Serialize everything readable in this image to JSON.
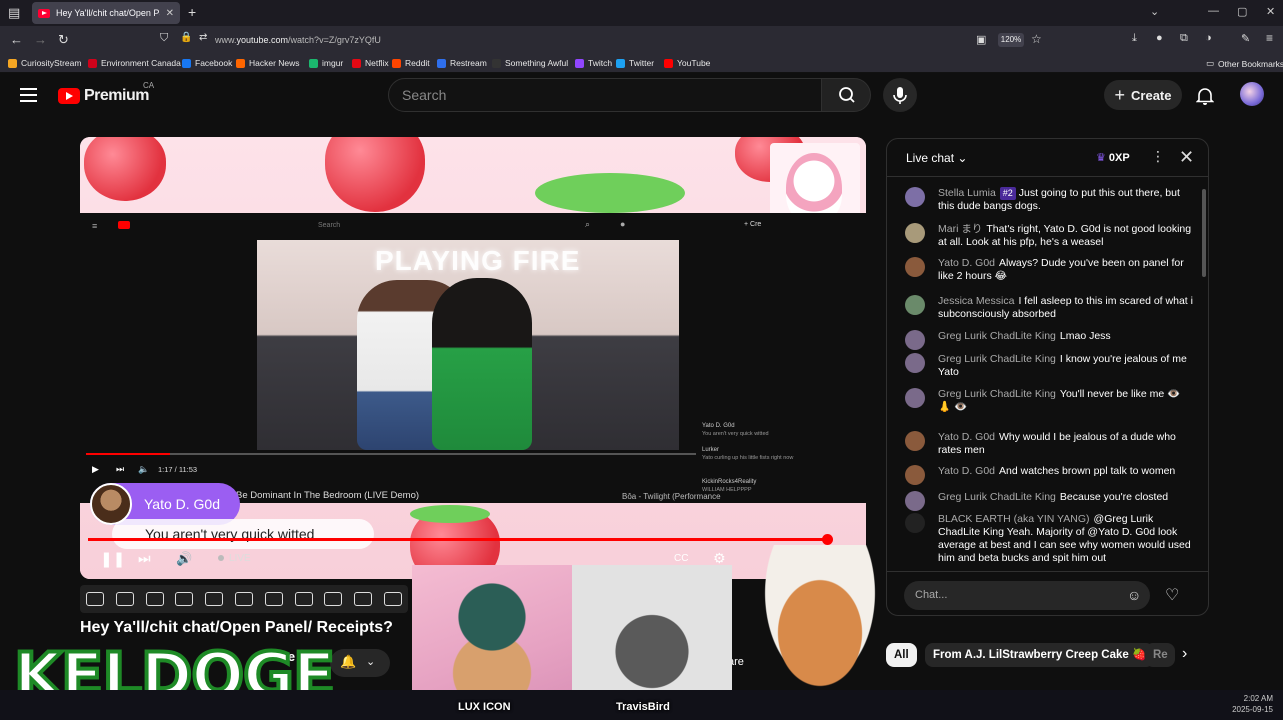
{
  "browser": {
    "tab_title": "Hey Ya'll/chit chat/Open Pa",
    "url_prefix": "www.",
    "url_domain": "youtube.com",
    "url_path": "/watch?v=Z/grv7zYQfU",
    "zoom": "120%",
    "bookmarks": [
      {
        "label": "CuriosityStream",
        "color": "#f5a623"
      },
      {
        "label": "Environment Canada",
        "color": "#d0021b"
      },
      {
        "label": "Facebook",
        "color": "#1877f2"
      },
      {
        "label": "Hacker News",
        "color": "#ff6600"
      },
      {
        "label": "imgur",
        "color": "#1bb76e"
      },
      {
        "label": "Netflix",
        "color": "#e50914"
      },
      {
        "label": "Reddit",
        "color": "#ff4500"
      },
      {
        "label": "Restream",
        "color": "#2f6fed"
      },
      {
        "label": "Something Awful",
        "color": "#333333"
      },
      {
        "label": "Twitch",
        "color": "#9146ff"
      },
      {
        "label": "Twitter",
        "color": "#1da1f2"
      },
      {
        "label": "YouTube",
        "color": "#ff0000"
      }
    ],
    "other_bookmarks": "Other Bookmarks"
  },
  "header": {
    "logo_text": "Premium",
    "region": "CA",
    "search_placeholder": "Search",
    "create_label": "Create"
  },
  "player": {
    "inner_time": "1:17 / 11:53",
    "inner_title": "Be Dominant In The Bedroom (LIVE Demo)",
    "inner_next": "Bôa - Twilight (Performance",
    "sign_text": "PLAYING FIRE",
    "inner_search": "Search",
    "inner_create": "Cre",
    "inner_chat": [
      {
        "author": "Yato D. G0d",
        "text": "You aren't very quick witted"
      },
      {
        "author": "Lurker",
        "text": "Yato curling up his little fists right now"
      },
      {
        "author": "KickinRocks4Reality",
        "text": "WILLIAM HELPPPP"
      }
    ],
    "alert_name": "Yato D. G0d",
    "alert_text": "You aren't very quick witted",
    "live_label": "LIVE"
  },
  "video": {
    "title": "Hey Ya'll/chit chat/Open Panel/ Receipts?",
    "channel_partial": "Cake",
    "share_partial": "are"
  },
  "overlay": {
    "brand": "KELDOGE",
    "cam1_label": "LUX ICON",
    "cam2_label": "TravisBird"
  },
  "chat": {
    "title": "Live chat",
    "xp": "0XP",
    "input_placeholder": "Chat...",
    "messages": [
      {
        "author": "Stella Lumia",
        "badge": "#2",
        "text": "Just going to put this out there, but this dude bangs dogs.",
        "avatar": "#7d6fa6"
      },
      {
        "author": "Mari まり",
        "text": "That's right, Yato D. G0d is not good looking at all. Look at his pfp, he's a weasel",
        "avatar": "#a89a7a"
      },
      {
        "author": "Yato D. G0d",
        "text": "Always? Dude you've been on panel for like 2 hours 😂",
        "avatar": "#8a5a3c"
      },
      {
        "author": "Jessica Messica",
        "text": "I fell asleep to this im scared of what i subconsciously absorbed",
        "avatar": "#6a8a6a"
      },
      {
        "author": "Greg Lurik ChadLite King",
        "text": "Lmao Jess",
        "avatar": "#7a6a8a"
      },
      {
        "author": "Greg Lurik ChadLite King",
        "text": "I know you're jealous of me Yato",
        "avatar": "#7a6a8a"
      },
      {
        "author": "Greg Lurik ChadLite King",
        "text": "You'll never be like me 👁️ 👃 👁️",
        "avatar": "#7a6a8a"
      },
      {
        "author": "Yato D. G0d",
        "text": "Why would I be jealous of a dude who rates men",
        "avatar": "#8a5a3c"
      },
      {
        "author": "Yato D. G0d",
        "text": "And watches brown ppl talk to women",
        "avatar": "#8a5a3c"
      },
      {
        "author": "Greg Lurik ChadLite King",
        "text": "Because you're closted",
        "avatar": "#7a6a8a"
      },
      {
        "author": "BLACK EARTH (aka YIN YANG)",
        "text": "@Greg Lurik ChadLite King Yeah. Majority of @Yato D. G0d look average at best and I can see why women would used him and beta bucks and spit him out",
        "avatar": "#222222"
      }
    ]
  },
  "chips": [
    "All",
    "From A.J. LilStrawberry Creep Cake 🍓",
    "Re"
  ],
  "clock": {
    "time": "2:02 AM",
    "date": "2025-09-15"
  }
}
